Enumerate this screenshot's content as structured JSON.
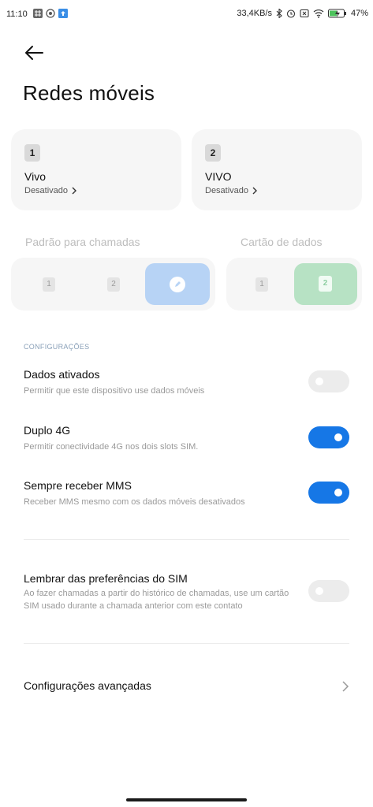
{
  "status_bar": {
    "time": "11:10",
    "net_speed": "33,4KB/s",
    "battery": "47"
  },
  "header": {
    "title": "Redes móveis"
  },
  "sims": [
    {
      "slot": "1",
      "name": "Vivo",
      "status": "Desativado"
    },
    {
      "slot": "2",
      "name": "VIVO",
      "status": "Desativado"
    }
  ],
  "selectors": {
    "calls": {
      "label": "Padrão para chamadas",
      "options": [
        "1",
        "2"
      ],
      "selected": "edit"
    },
    "data": {
      "label": "Cartão de dados",
      "options": [
        "1",
        "2"
      ],
      "selected": "2"
    }
  },
  "section": {
    "title": "CONFIGURAÇÕES"
  },
  "settings": [
    {
      "title": "Dados ativados",
      "subtitle": "Permitir que este dispositivo use dados móveis",
      "enabled": false
    },
    {
      "title": "Duplo 4G",
      "subtitle": "Permitir conectividade 4G nos dois slots SIM.",
      "enabled": true
    },
    {
      "title": "Sempre receber MMS",
      "subtitle": "Receber MMS mesmo com os dados móveis desativados",
      "enabled": true
    },
    {
      "title": "Lembrar das preferências do SIM",
      "subtitle": "Ao fazer chamadas a partir do histórico de chamadas, use um cartão SIM usado durante a chamada anterior com este contato",
      "enabled": false
    }
  ],
  "advanced": {
    "label": "Configurações avançadas"
  },
  "colors": {
    "accent": "#1677e6",
    "call_selected": "#b7d3f5",
    "data_selected": "#b7e2c4"
  }
}
